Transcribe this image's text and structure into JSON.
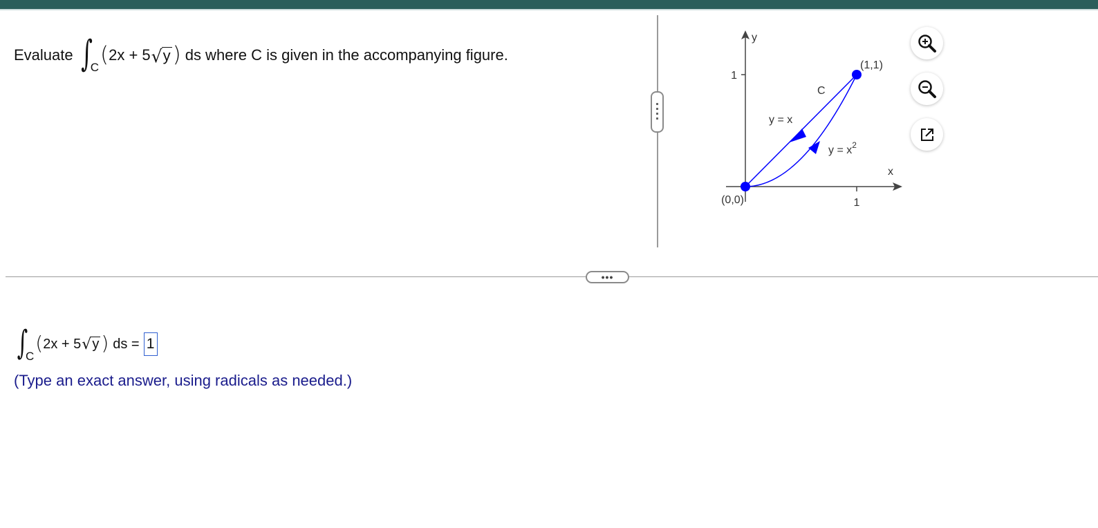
{
  "question": {
    "prefix": "Evaluate",
    "int_sub": "C",
    "expr_before": "2x + 5",
    "radicand": "y",
    "suffix": "ds where C is given in the accompanying figure."
  },
  "figure": {
    "y_axis_label": "y",
    "x_axis_label": "x",
    "y_tick": "1",
    "x_tick": "1",
    "origin_label": "(0,0)",
    "end_label": "(1,1)",
    "curve_label": "C",
    "line_label": "y = x",
    "parabola_label_base": "y = x",
    "parabola_label_exp": "2",
    "color": "#0000ff"
  },
  "tools": {
    "zoom_in": "zoom-in-icon",
    "zoom_out": "zoom-out-icon",
    "popout": "popout-icon"
  },
  "splitter": {
    "dots": "•••"
  },
  "answer": {
    "int_sub": "C",
    "expr_before": "2x + 5",
    "radicand": "y",
    "suffix": "ds =",
    "value": "1"
  },
  "hint": "(Type an exact answer, using radicals as needed.)"
}
